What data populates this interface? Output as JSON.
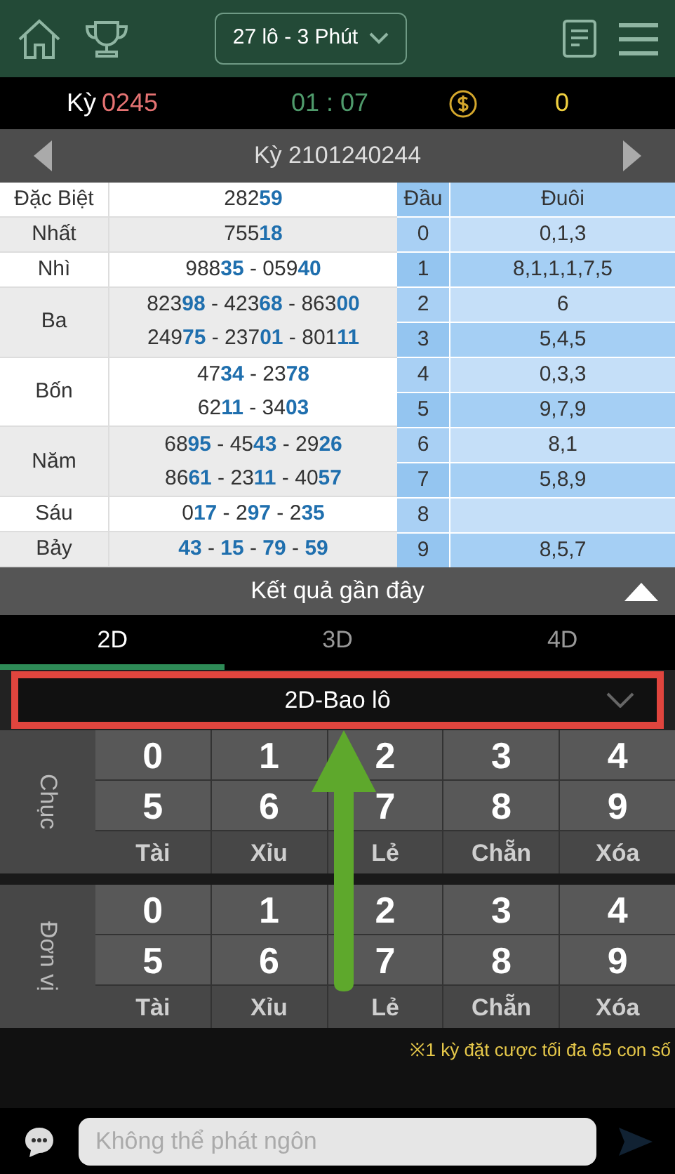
{
  "header": {
    "game_selector": "27 lô - 3 Phút"
  },
  "status": {
    "period_label": "Kỳ",
    "period": "0245",
    "countdown": "01 : 07",
    "balance": "0"
  },
  "period_nav": {
    "title": "Kỳ 2101240244"
  },
  "results": {
    "prizes": [
      {
        "name": "Đặc Biệt",
        "lines": [
          "282**59**"
        ]
      },
      {
        "name": "Nhất",
        "lines": [
          "755**18**"
        ]
      },
      {
        "name": "Nhì",
        "lines": [
          "988**35** - 059**40**"
        ]
      },
      {
        "name": "Ba",
        "lines": [
          "823**98** - 423**68** - 863**00**",
          "249**75** - 237**01** - 801**11**"
        ]
      },
      {
        "name": "Bốn",
        "lines": [
          "47**34** - 23**78**",
          "62**11** - 34**03**"
        ]
      },
      {
        "name": "Năm",
        "lines": [
          "68**95** - 45**43** - 29**26**",
          "86**61** - 23**11** - 40**57**"
        ]
      },
      {
        "name": "Sáu",
        "lines": [
          "0**17** - 2**97** - 2**35**"
        ]
      },
      {
        "name": "Bảy",
        "lines": [
          "**43** - **15** - **79** - **59**"
        ]
      }
    ],
    "head_header": "Đầu",
    "tail_header": "Đuôi",
    "digits": [
      {
        "head": "0",
        "tail": "0,1,3"
      },
      {
        "head": "1",
        "tail": "8,1,1,1,7,5"
      },
      {
        "head": "2",
        "tail": "6"
      },
      {
        "head": "3",
        "tail": "5,4,5"
      },
      {
        "head": "4",
        "tail": "0,3,3"
      },
      {
        "head": "5",
        "tail": "9,7,9"
      },
      {
        "head": "6",
        "tail": "8,1"
      },
      {
        "head": "7",
        "tail": "5,8,9"
      },
      {
        "head": "8"
      },
      {
        "head": "9",
        "tail": "8,5,7"
      }
    ]
  },
  "recent": {
    "title": "Kết quả gần đây"
  },
  "tabs": [
    {
      "label": "2D",
      "selected": true
    },
    {
      "label": "3D",
      "selected": false
    },
    {
      "label": "4D",
      "selected": false
    }
  ],
  "bet_type": "2D-Bao lô",
  "keypads": [
    {
      "label": "Chục",
      "keys": [
        "0",
        "1",
        "2",
        "3",
        "4",
        "5",
        "6",
        "7",
        "8",
        "9"
      ],
      "actions": [
        "Tài",
        "Xỉu",
        "Lẻ",
        "Chẵn",
        "Xóa"
      ]
    },
    {
      "label": "Đơn vị",
      "keys": [
        "0",
        "1",
        "2",
        "3",
        "4",
        "5",
        "6",
        "7",
        "8",
        "9"
      ],
      "actions": [
        "Tài",
        "Xỉu",
        "Lẻ",
        "Chẵn",
        "Xóa"
      ]
    }
  ],
  "notice": "※1 kỳ đặt cược tối đa 65 con số",
  "chat": {
    "placeholder": "Không thể phát ngôn"
  }
}
